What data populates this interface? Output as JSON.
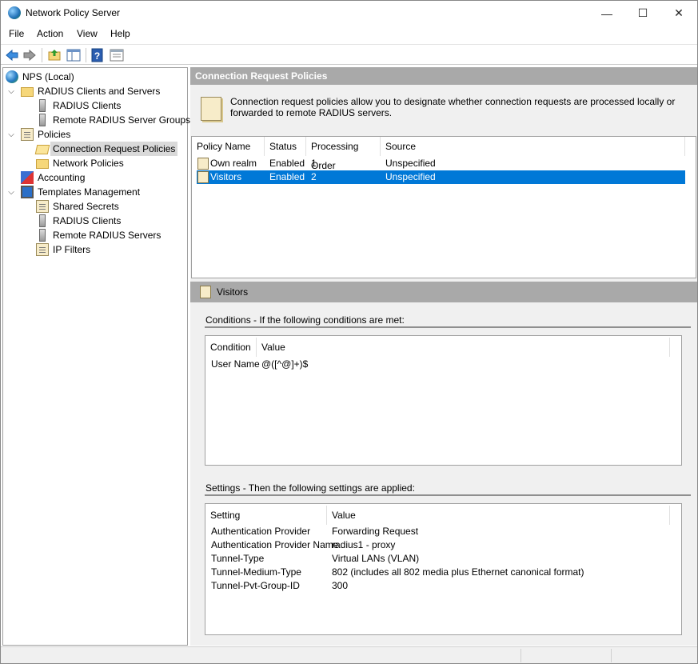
{
  "window": {
    "title": "Network Policy Server",
    "icon": "nps-globe-icon",
    "minimize": "—",
    "maximize": "☐",
    "close": "✕"
  },
  "menu": [
    "File",
    "Action",
    "View",
    "Help"
  ],
  "toolbar": {
    "buttons": [
      "back-icon",
      "forward-icon",
      "up-folder-icon",
      "show-hide-tree-icon",
      "help-icon",
      "properties-icon"
    ]
  },
  "tree": {
    "root": "NPS (Local)",
    "radius_clients_and_servers": "RADIUS Clients and Servers",
    "radius_clients": "RADIUS Clients",
    "remote_radius_server_groups": "Remote RADIUS Server Groups",
    "policies": "Policies",
    "connection_request_policies": "Connection Request Policies",
    "network_policies": "Network Policies",
    "accounting": "Accounting",
    "templates_management": "Templates Management",
    "shared_secrets": "Shared Secrets",
    "tm_radius_clients": "RADIUS Clients",
    "remote_radius_servers": "Remote RADIUS Servers",
    "ip_filters": "IP Filters"
  },
  "main": {
    "header": "Connection Request Policies",
    "description": "Connection request policies allow you to designate whether connection requests are processed locally or forwarded to remote RADIUS servers.",
    "columns": [
      "Policy Name",
      "Status",
      "Processing Order",
      "Source"
    ],
    "rows": [
      {
        "name": "Own realm",
        "status": "Enabled",
        "order": "1",
        "source": "Unspecified"
      },
      {
        "name": "Visitors",
        "status": "Enabled",
        "order": "2",
        "source": "Unspecified"
      }
    ]
  },
  "detail": {
    "header": "Visitors",
    "conditions_title": "Conditions - If the following conditions are met:",
    "conditions_columns": [
      "Condition",
      "Value"
    ],
    "conditions": [
      {
        "condition": "User Name",
        "value": "@([^@]+)$"
      }
    ],
    "settings_title": "Settings - Then the following settings are applied:",
    "settings_columns": [
      "Setting",
      "Value"
    ],
    "settings": [
      {
        "setting": "Authentication Provider",
        "value": "Forwarding Request"
      },
      {
        "setting": "Authentication Provider Name",
        "value": "radius1 - proxy"
      },
      {
        "setting": "Tunnel-Type",
        "value": "Virtual LANs (VLAN)"
      },
      {
        "setting": "Tunnel-Medium-Type",
        "value": "802 (includes all 802 media plus Ethernet canonical format)"
      },
      {
        "setting": "Tunnel-Pvt-Group-ID",
        "value": "300"
      }
    ]
  },
  "colors": {
    "selection": "#0078d7",
    "pane_header": "#a9a9a9",
    "tree_selection": "#d9d9d9"
  }
}
